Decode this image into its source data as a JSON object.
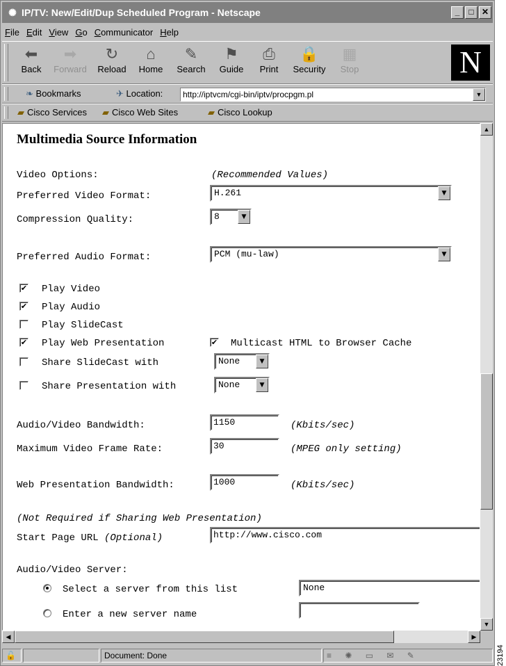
{
  "window": {
    "title": "IP/TV: New/Edit/Dup Scheduled Program - Netscape",
    "minimize": "_",
    "maximize": "□",
    "close": "✕"
  },
  "menu": [
    "File",
    "Edit",
    "View",
    "Go",
    "Communicator",
    "Help"
  ],
  "nav": [
    {
      "label": "Back",
      "icon": "back-arrow-icon",
      "enabled": true
    },
    {
      "label": "Forward",
      "icon": "forward-arrow-icon",
      "enabled": false
    },
    {
      "label": "Reload",
      "icon": "reload-icon",
      "enabled": true
    },
    {
      "label": "Home",
      "icon": "home-icon",
      "enabled": true
    },
    {
      "label": "Search",
      "icon": "search-icon",
      "enabled": true
    },
    {
      "label": "Guide",
      "icon": "guide-icon",
      "enabled": true
    },
    {
      "label": "Print",
      "icon": "printer-icon",
      "enabled": true
    },
    {
      "label": "Security",
      "icon": "lock-icon",
      "enabled": true
    },
    {
      "label": "Stop",
      "icon": "stop-icon",
      "enabled": false
    }
  ],
  "logo": "N",
  "location": {
    "bookmarks": "Bookmarks",
    "label": "Location:",
    "url": "http://iptvcm/cgi-bin/iptv/procpgm.pl"
  },
  "personal": [
    "Cisco Services",
    "Cisco Web Sites",
    "Cisco Lookup"
  ],
  "form": {
    "heading": "Multimedia Source Information",
    "video_options": "Video Options:",
    "recommended": "(Recommended Values)",
    "video_format_label": "Preferred Video Format:",
    "video_format": "H.261",
    "compression_label": "Compression Quality:",
    "compression": "8",
    "audio_format_label": "Preferred Audio Format:",
    "audio_format": "PCM (mu-law)",
    "play_video": "Play Video",
    "play_audio": "Play Audio",
    "play_slidecast": "Play SlideCast",
    "play_web": "Play Web Presentation",
    "multicast": "Multicast HTML to Browser Cache",
    "share_slidecast": "Share SlideCast with",
    "share_slidecast_value": "None",
    "share_presentation": "Share Presentation with",
    "share_presentation_value": "None",
    "av_bandwidth_label": "Audio/Video Bandwidth:",
    "av_bandwidth": "1150",
    "kbits1": "(Kbits/sec)",
    "frame_rate_label": "Maximum Video Frame Rate:",
    "frame_rate": "30",
    "mpeg_note": "(MPEG only setting)",
    "web_bandwidth_label": "Web Presentation Bandwidth:",
    "web_bandwidth": "1000",
    "kbits2": "(Kbits/sec)",
    "not_required": "(Not Required if Sharing Web Presentation)",
    "start_page_label": "Start Page URL",
    "optional": "(Optional)",
    "start_page": "http://www.cisco.com",
    "server_label": "Audio/Video Server:",
    "select_server": "Select a server from this list",
    "server_value": "None",
    "enter_server": "Enter a new server name",
    "enter_server_value": ""
  },
  "checks": {
    "play_video": true,
    "play_audio": true,
    "play_slidecast": false,
    "play_web": true,
    "multicast": true,
    "share_slidecast": false,
    "share_presentation": false
  },
  "status": {
    "text": "Document: Done"
  },
  "figure_id": "23194"
}
